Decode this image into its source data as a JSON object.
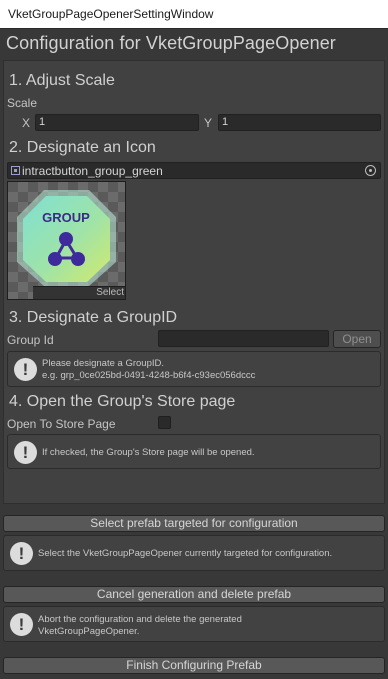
{
  "window": {
    "title": "VketGroupPageOpenerSettingWindow"
  },
  "main_title": "Configuration for VketGroupPageOpener",
  "section1": {
    "heading": "1. Adjust Scale",
    "scale_label": "Scale",
    "x_label": "X",
    "x_value": "1",
    "y_label": "Y",
    "y_value": "1"
  },
  "section2": {
    "heading": "2. Designate an Icon",
    "icon_name": "intractbutton_group_green",
    "preview_text": "GROUP",
    "select_label": "Select"
  },
  "section3": {
    "heading": "3. Designate a GroupID",
    "group_id_label": "Group Id",
    "group_id_value": "",
    "open_label": "Open",
    "help_line1": "Please designate a GroupID.",
    "help_line2": "e.g. grp_0ce025bd-0491-4248-b6f4-c93ec056dccc"
  },
  "section4": {
    "heading": "4. Open the Group's Store page",
    "toggle_label": "Open To Store Page",
    "toggle_checked": false,
    "help": "If checked, the Group's Store page will be opened."
  },
  "actions": {
    "select_prefab_label": "Select prefab targeted for configuration",
    "select_prefab_help": "Select the VketGroupPageOpener currently targeted for configuration.",
    "cancel_label": "Cancel generation and delete prefab",
    "cancel_help_line1": "Abort the configuration and delete the generated",
    "cancel_help_line2": "VketGroupPageOpener.",
    "finish_label": "Finish Configuring Prefab"
  },
  "colors": {
    "background": "#383838",
    "panel": "#414141",
    "field": "#2a2a2a",
    "button": "#585858"
  }
}
